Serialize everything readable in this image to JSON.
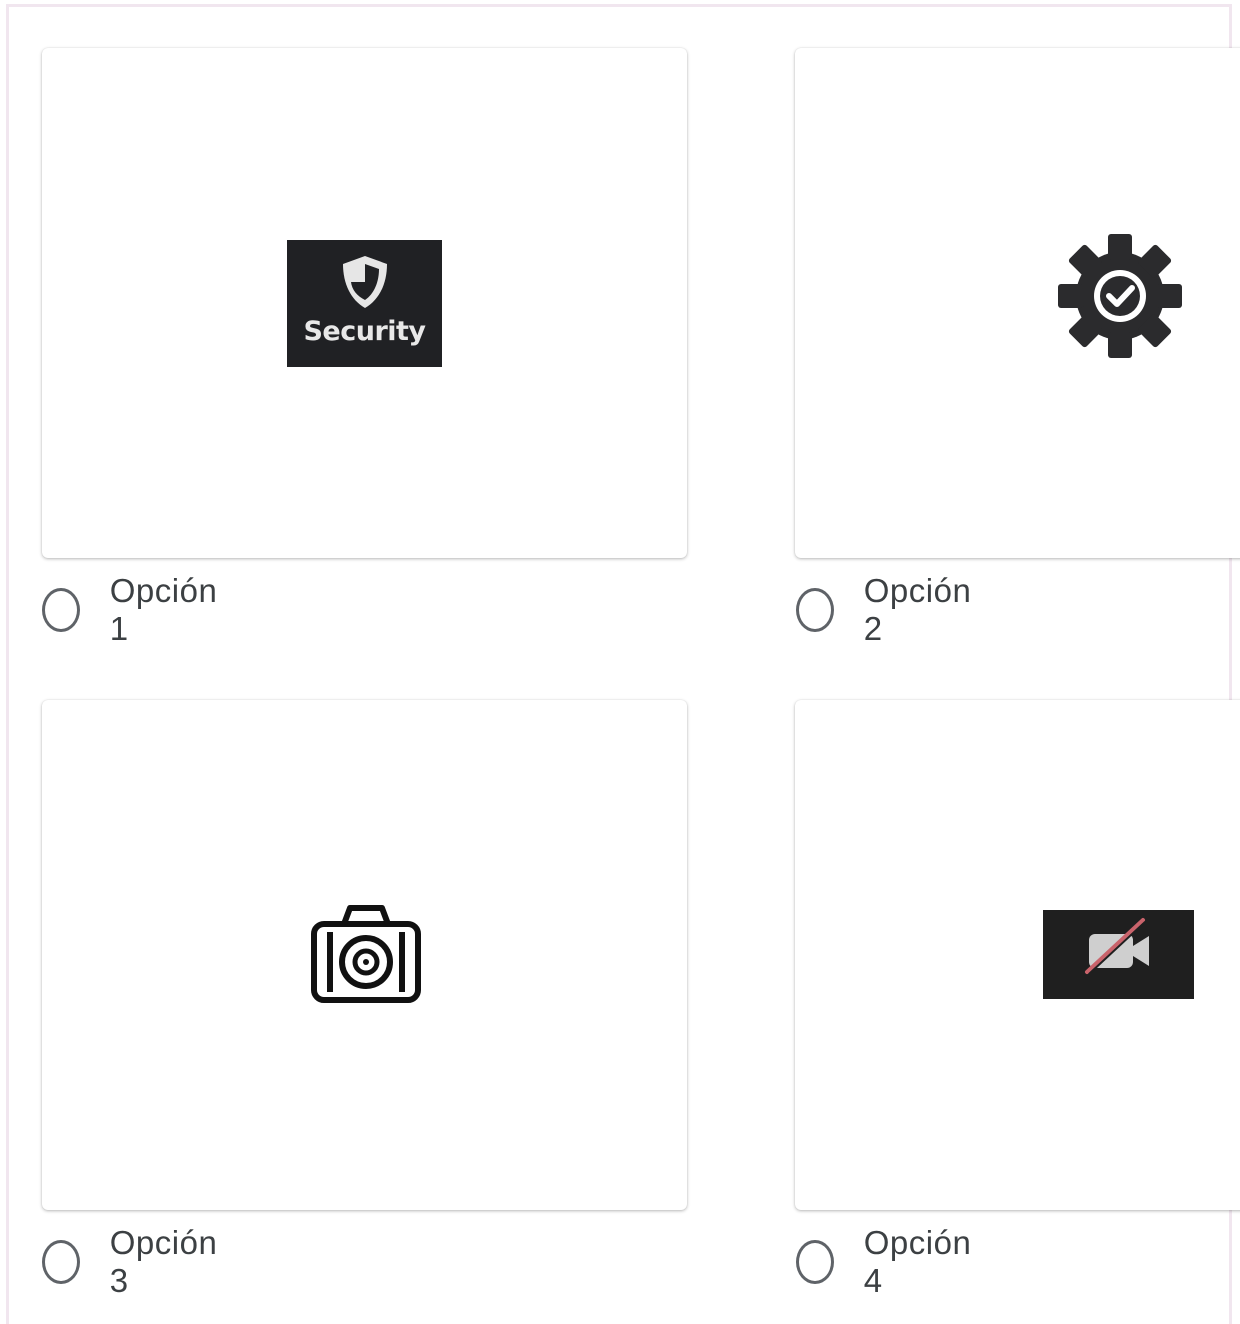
{
  "options": [
    {
      "label": "Opción 1",
      "image_caption": "Security",
      "icon": "shield-icon"
    },
    {
      "label": "Opción 2",
      "icon": "gear-check-icon"
    },
    {
      "label": "Opción 3",
      "icon": "camera-icon"
    },
    {
      "label": "Opción 4",
      "icon": "video-off-icon"
    }
  ],
  "colors": {
    "frame_border": "#f1e6ef",
    "icon_dark": "#202124",
    "radio_border": "#5f6368",
    "label_text": "#3c4043",
    "video_slash": "#c9636b"
  }
}
